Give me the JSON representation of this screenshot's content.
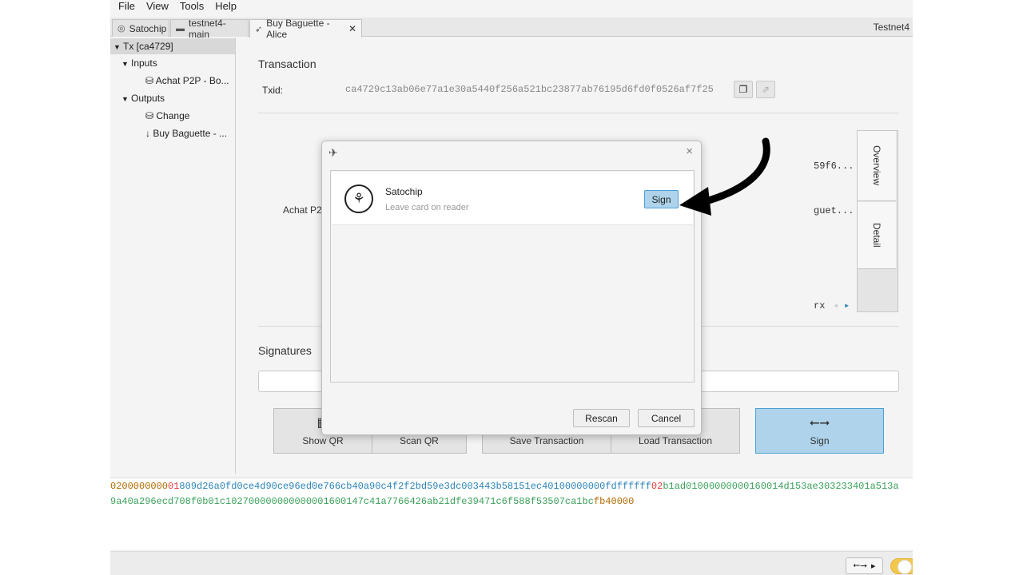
{
  "menu": [
    "File",
    "View",
    "Tools",
    "Help"
  ],
  "tabs": [
    {
      "label": "Satochip",
      "icon": "satochip-icon"
    },
    {
      "label": "testnet4-main",
      "icon": "wallet-icon"
    },
    {
      "label": "Buy Baguette - Alice",
      "icon": "send-icon",
      "close": "✕"
    }
  ],
  "network": "Testnet4",
  "tree": {
    "root": "Tx [ca4729]",
    "inputs_label": "Inputs",
    "input_item": "Achat P2P - Bo...",
    "outputs_label": "Outputs",
    "change_item": "Change",
    "output_item": "Buy Baguette - ..."
  },
  "transaction": {
    "heading": "Transaction",
    "txid_label": "Txid:",
    "txid": "ca4729c13ab06e77a1e30a5440f256a521bc23877ab76195d6fd0f0526af7f25",
    "diagram_input_label": "Achat P2P",
    "diagram_frag_1": "59f6...",
    "diagram_frag_2": "guet...",
    "diagram_frag_3": "rx",
    "side_tabs": [
      "Overview",
      "Detail"
    ]
  },
  "signatures": {
    "heading": "Signatures"
  },
  "actions": {
    "show_qr": "Show QR",
    "scan_qr": "Scan QR",
    "save": "Save Transaction",
    "load": "Load Transaction",
    "sign": "Sign"
  },
  "hex": {
    "line1": [
      {
        "t": "0200000000",
        "c": "or"
      },
      {
        "t": "01",
        "c": "red"
      },
      {
        "t": "809d26a0fd0ce4d90ce96ed0e766cb40a90c4f2f2bd59e3dc003443b58151ec40100000000",
        "c": "blue"
      },
      {
        "t": "fdffffff",
        "c": "blue"
      },
      {
        "t": "02",
        "c": "red"
      },
      {
        "t": "b1ad01000000000160014d153ae303233401a513a",
        "c": "green"
      }
    ],
    "line2": [
      {
        "t": "9a40a296ecd708f0b01c102700000000000001600147c41a7766426ab21dfe39471c6f588f53507ca1bc",
        "c": "green"
      },
      {
        "t": "fb40000",
        "c": "or"
      }
    ]
  },
  "status": {
    "usb_icon": "usb-icon"
  },
  "dialog": {
    "close": "×",
    "device_name": "Satochip",
    "device_status": "Leave card on reader",
    "sign_label": "Sign",
    "rescan_label": "Rescan",
    "cancel_label": "Cancel"
  },
  "colors": {
    "accent_fill": "#aed3ea",
    "accent_border": "#4ba0d6"
  }
}
